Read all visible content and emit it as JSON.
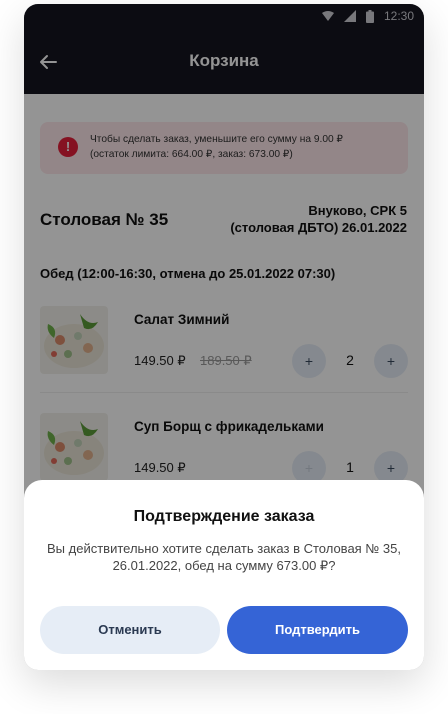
{
  "status_bar": {
    "time": "12:30"
  },
  "header": {
    "title": "Корзина"
  },
  "alert": {
    "line1": "Чтобы сделать заказ, уменьшите его сумму на 9.00 ₽",
    "line2": "(остаток лимита: 664.00 ₽, заказ: 673.00 ₽)",
    "icon": "!"
  },
  "canteen": {
    "name": "Столовая № 35",
    "location_line1": "Внуково, СРК 5",
    "location_line2": "(столовая ДБТО) 26.01.2022"
  },
  "meal": {
    "title": "Обед (12:00-16:30, отмена до 25.01.2022 07:30)"
  },
  "items": [
    {
      "name": "Салат Зимний",
      "price": "149.50 ₽",
      "old_price": "189.50 ₽",
      "quantity": "2",
      "minus": "+",
      "plus": "+"
    },
    {
      "name": "Суп Борщ с фрикадельками",
      "price": "149.50 ₽",
      "old_price": "",
      "quantity": "1",
      "minus": "+",
      "plus": "+"
    }
  ],
  "dialog": {
    "title": "Подтверждение заказа",
    "message": "Вы действительно хотите сделать заказ в Столовая № 35, 26.01.2022, обед на сумму 673.00 ₽?",
    "cancel_label": "Отменить",
    "confirm_label": "Подтвердить"
  },
  "colors": {
    "header_bg": "#16161f",
    "alert_bg": "#fde7ea",
    "alert_icon": "#e5203b",
    "primary": "#3564d6",
    "secondary_button": "#e6edf6"
  },
  "icons": {
    "back": "arrow-left-icon",
    "wifi": "wifi-icon",
    "signal": "signal-icon",
    "battery": "battery-icon",
    "alert": "alert-circle-icon"
  }
}
